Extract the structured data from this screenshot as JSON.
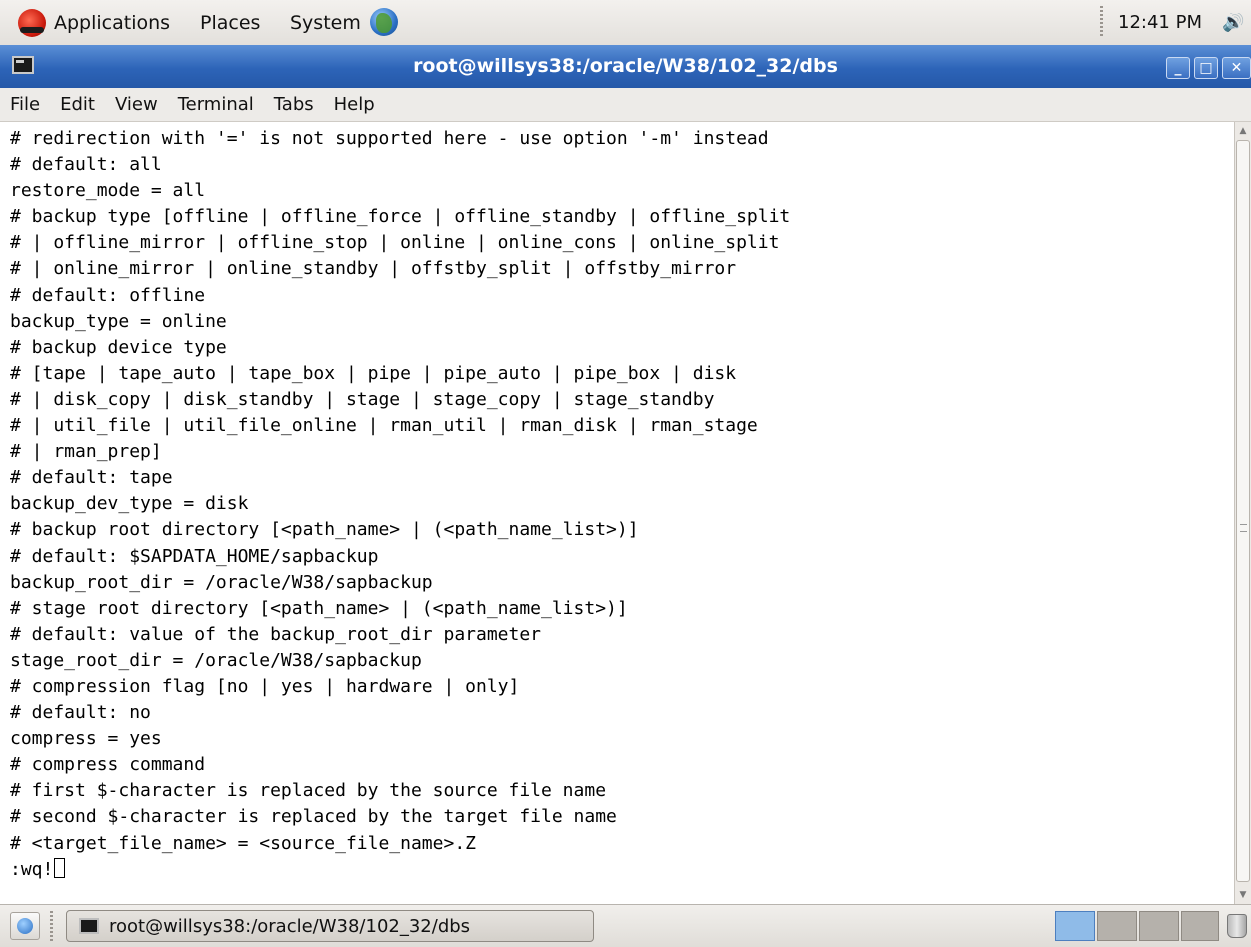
{
  "top_panel": {
    "menus": [
      "Applications",
      "Places",
      "System"
    ],
    "clock": "12:41 PM"
  },
  "window": {
    "title": "root@willsys38:/oracle/W38/102_32/dbs",
    "menubar": [
      "File",
      "Edit",
      "View",
      "Terminal",
      "Tabs",
      "Help"
    ]
  },
  "terminal": {
    "lines": [
      "# redirection with '=' is not supported here - use option '-m' instead",
      "# default: all",
      "restore_mode = all",
      "# backup type [offline | offline_force | offline_standby | offline_split",
      "# | offline_mirror | offline_stop | online | online_cons | online_split",
      "# | online_mirror | online_standby | offstby_split | offstby_mirror",
      "# default: offline",
      "backup_type = online",
      "# backup device type",
      "# [tape | tape_auto | tape_box | pipe | pipe_auto | pipe_box | disk",
      "# | disk_copy | disk_standby | stage | stage_copy | stage_standby",
      "# | util_file | util_file_online | rman_util | rman_disk | rman_stage",
      "# | rman_prep]",
      "# default: tape",
      "backup_dev_type = disk",
      "# backup root directory [<path_name> | (<path_name_list>)]",
      "# default: $SAPDATA_HOME/sapbackup",
      "backup_root_dir = /oracle/W38/sapbackup",
      "# stage root directory [<path_name> | (<path_name_list>)]",
      "# default: value of the backup_root_dir parameter",
      "stage_root_dir = /oracle/W38/sapbackup",
      "# compression flag [no | yes | hardware | only]",
      "# default: no",
      "compress = yes",
      "# compress command",
      "# first $-character is replaced by the source file name",
      "# second $-character is replaced by the target file name",
      "# <target_file_name> = <source_file_name>.Z"
    ],
    "prompt": ":wq!"
  },
  "taskbar": {
    "task_label": "root@willsys38:/oracle/W38/102_32/dbs",
    "workspaces": 4,
    "active_workspace": 1
  }
}
